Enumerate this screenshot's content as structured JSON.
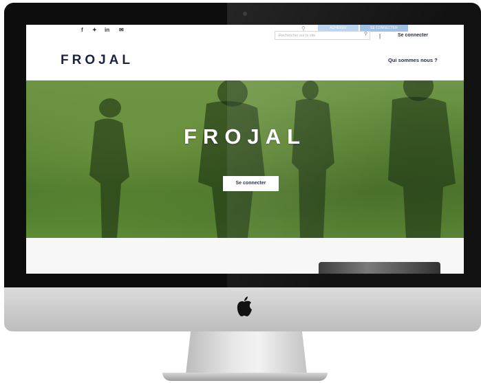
{
  "topbar": {
    "social_icons": [
      "facebook-icon",
      "twitter-icon",
      "linkedin-icon",
      "email-icon"
    ],
    "social_glyphs": [
      "f",
      "✦",
      "in",
      "✉"
    ],
    "search_placeholder": "Rechercher sur le site",
    "adherer_label": "ADHÉRER",
    "seconnecter_top_label": "SE CONNECTER",
    "separator": "|",
    "login_link": "Se connecter"
  },
  "header": {
    "logo": "FROJAL",
    "nav_about": "Qui sommes nous ?"
  },
  "hero": {
    "title": "FROJAL",
    "button_label": "Se connecter"
  },
  "colors": {
    "brand_navy": "#1c2340",
    "grass_green": "#5a8535",
    "top_button_blue": "#9dbfe2"
  }
}
